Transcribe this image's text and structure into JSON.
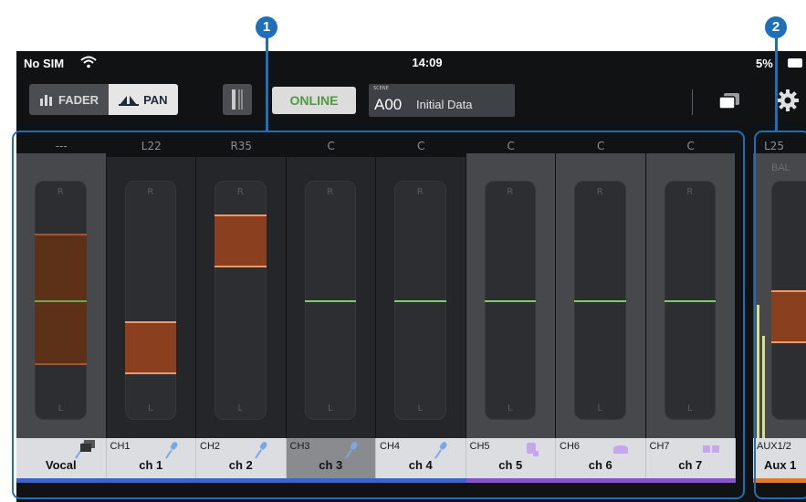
{
  "status_bar": {
    "carrier": "No SIM",
    "time": "14:09",
    "battery_text": "5",
    "battery_fragment": "%"
  },
  "toolbar": {
    "fader_label": "FADER",
    "pan_label": "PAN",
    "online_label": "ONLINE",
    "scene_caption": "SCENE",
    "scene_number": "A00",
    "scene_name": "Initial Data"
  },
  "channels": [
    {
      "pan": "---",
      "number": "",
      "name": "Vocal",
      "pan_position": 0.5,
      "selected": false,
      "color": "#3c64c8",
      "icon": "mic-icon",
      "dimmed": true
    },
    {
      "pan": "L22",
      "number": "CH1",
      "name": "ch 1",
      "pan_position": 0.33,
      "selected": false,
      "color": "#3c64c8",
      "icon": "mic-icon",
      "dimmed": false
    },
    {
      "pan": "R35",
      "number": "CH2",
      "name": "ch 2",
      "pan_position": 0.775,
      "selected": false,
      "color": "#3c64c8",
      "icon": "mic-icon",
      "dimmed": false
    },
    {
      "pan": "C",
      "number": "CH3",
      "name": "ch 3",
      "pan_position": 0.5,
      "selected": true,
      "color": "#3c64c8",
      "icon": "mic-icon",
      "dimmed": false
    },
    {
      "pan": "C",
      "number": "CH4",
      "name": "ch 4",
      "pan_position": 0.5,
      "selected": false,
      "color": "#3c64c8",
      "icon": "mic-icon",
      "dimmed": false
    },
    {
      "pan": "C",
      "number": "CH5",
      "name": "ch 5",
      "pan_position": 0.5,
      "selected": false,
      "color": "#8a52c8",
      "icon": "instrument-icon",
      "dimmed": false
    },
    {
      "pan": "C",
      "number": "CH6",
      "name": "ch 6",
      "pan_position": 0.5,
      "selected": false,
      "color": "#8a52c8",
      "icon": "drum-icon",
      "dimmed": false
    },
    {
      "pan": "C",
      "number": "CH7",
      "name": "ch 7",
      "pan_position": 0.5,
      "selected": false,
      "color": "#8a52c8",
      "icon": "keyboard-icon",
      "dimmed": false
    }
  ],
  "aux": {
    "pan": "L25",
    "balance_label": "BAL",
    "number": "AUX1/2",
    "name": "Aux 1",
    "color": "#e07a2a"
  },
  "track_labels": {
    "right": "R",
    "left": "L"
  },
  "callouts": {
    "one": "1",
    "two": "2"
  },
  "colors": {
    "accent_blue": "#1f6fb8",
    "pan_orange": "#f0986a",
    "center_green": "#7ecb6a",
    "online_green": "#4d9a3f"
  }
}
